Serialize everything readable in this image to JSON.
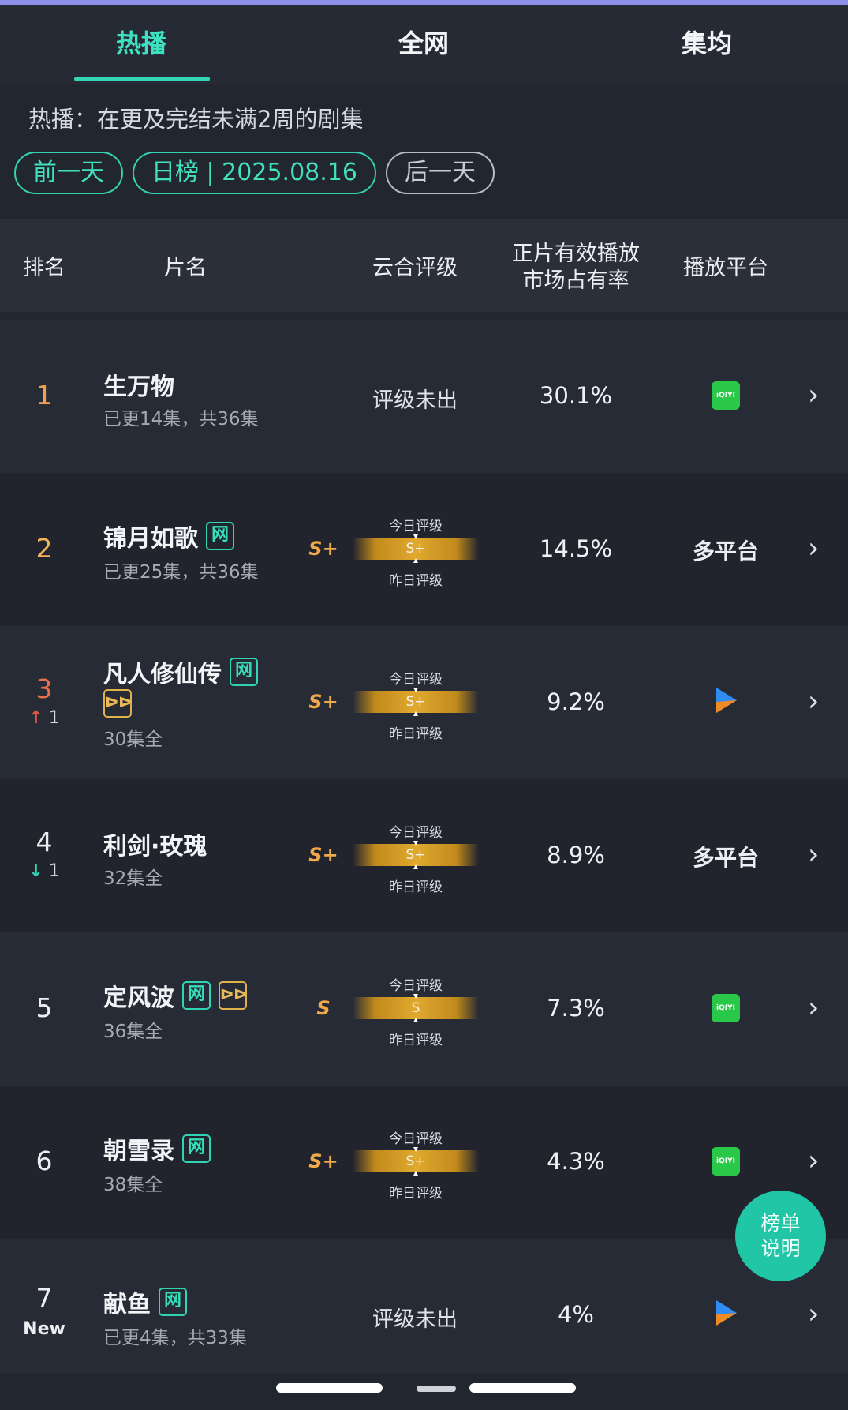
{
  "tabs": [
    "热播",
    "全网",
    "集均"
  ],
  "description": "热播：在更及完结未满2周的剧集",
  "date_nav": {
    "prev": "前一天",
    "current": "日榜 | 2025.08.16",
    "next": "后一天"
  },
  "columns": {
    "rank": "排名",
    "title": "片名",
    "rating": "云合评级",
    "share_line1": "正片有效播放",
    "share_line2": "市场占有率",
    "platform": "播放平台"
  },
  "rating_labels": {
    "today": "今日评级",
    "yesterday": "昨日评级",
    "unrated": "评级未出"
  },
  "rows": [
    {
      "rank": "1",
      "change": "",
      "title": "生万物",
      "sub": "已更14集，共36集",
      "grade": "",
      "bar": "",
      "share": "30.1%",
      "platform": "iqiyi"
    },
    {
      "rank": "2",
      "change": "",
      "title": "锦月如歌",
      "sub": "已更25集，共36集",
      "grade": "S+",
      "bar": "S+",
      "share": "14.5%",
      "platform": "多平台"
    },
    {
      "rank": "3",
      "change": "1",
      "title": "凡人修仙传",
      "sub": "30集全",
      "grade": "S+",
      "bar": "S+",
      "share": "9.2%",
      "platform": "youku"
    },
    {
      "rank": "4",
      "change": "1",
      "title": "利剑·玫瑰",
      "sub": "32集全",
      "grade": "S+",
      "bar": "S+",
      "share": "8.9%",
      "platform": "多平台"
    },
    {
      "rank": "5",
      "change": "",
      "title": "定风波",
      "sub": "36集全",
      "grade": "S",
      "bar": "S",
      "share": "7.3%",
      "platform": "iqiyi"
    },
    {
      "rank": "6",
      "change": "",
      "title": "朝雪录",
      "sub": "38集全",
      "grade": "S+",
      "bar": "S+",
      "share": "4.3%",
      "platform": "iqiyi"
    },
    {
      "rank": "7",
      "change": "New",
      "title": "献鱼",
      "sub": "已更4集，共33集",
      "grade": "",
      "bar": "",
      "share": "4%",
      "platform": "youku"
    }
  ],
  "badges": {
    "wang": "网",
    "ffw": "ᐅᐅ"
  },
  "platform_logos": {
    "iqiyi": "iQIYI"
  },
  "help_button": {
    "line1": "榜单",
    "line2": "说明"
  },
  "colors": {
    "accent": "#32d8b6",
    "grade": "#efa84a",
    "rank_up": "#e8553c",
    "rank_down": "#2fd4b4",
    "rank_top": "#f0a050"
  }
}
